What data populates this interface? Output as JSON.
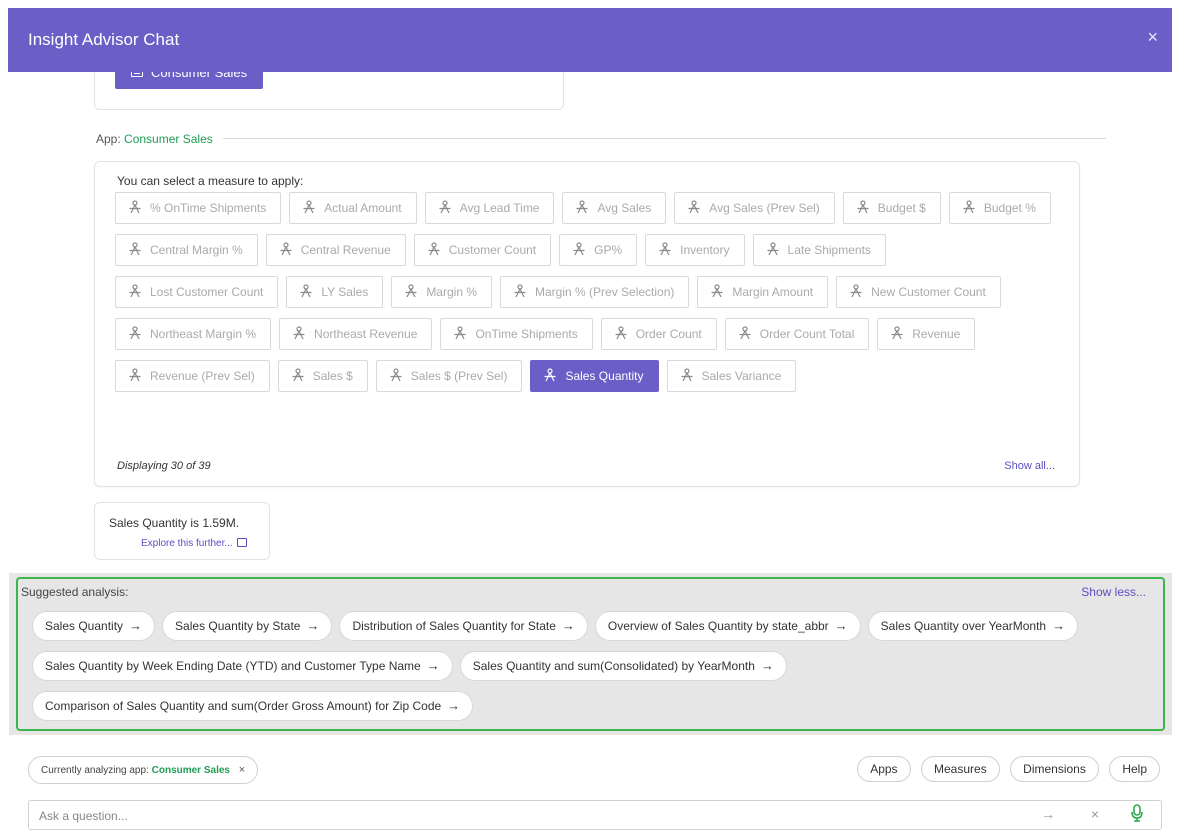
{
  "header": {
    "title": "Insight Advisor Chat",
    "close_glyph": "×"
  },
  "previous": {
    "app_button": "Consumer Sales"
  },
  "app_line": {
    "prefix": "App:",
    "app_name": "Consumer Sales"
  },
  "measures": {
    "intro": "You can select a measure to apply:",
    "items": [
      {
        "label": "% OnTime Shipments",
        "selected": false
      },
      {
        "label": "Actual Amount",
        "selected": false
      },
      {
        "label": "Avg Lead Time",
        "selected": false
      },
      {
        "label": "Avg Sales",
        "selected": false
      },
      {
        "label": "Avg Sales (Prev Sel)",
        "selected": false
      },
      {
        "label": "Budget $",
        "selected": false
      },
      {
        "label": "Budget %",
        "selected": false
      },
      {
        "label": "Central Margin %",
        "selected": false
      },
      {
        "label": "Central Revenue",
        "selected": false
      },
      {
        "label": "Customer Count",
        "selected": false
      },
      {
        "label": "GP%",
        "selected": false
      },
      {
        "label": "Inventory",
        "selected": false
      },
      {
        "label": "Late Shipments",
        "selected": false
      },
      {
        "label": "Lost Customer Count",
        "selected": false
      },
      {
        "label": "LY Sales",
        "selected": false
      },
      {
        "label": "Margin %",
        "selected": false
      },
      {
        "label": "Margin % (Prev Selection)",
        "selected": false
      },
      {
        "label": "Margin Amount",
        "selected": false
      },
      {
        "label": "New Customer Count",
        "selected": false
      },
      {
        "label": "Northeast Margin %",
        "selected": false
      },
      {
        "label": "Northeast Revenue",
        "selected": false
      },
      {
        "label": "OnTime Shipments",
        "selected": false
      },
      {
        "label": "Order Count",
        "selected": false
      },
      {
        "label": "Order Count Total",
        "selected": false
      },
      {
        "label": "Revenue",
        "selected": false
      },
      {
        "label": "Revenue (Prev Sel)",
        "selected": false
      },
      {
        "label": "Sales $",
        "selected": false
      },
      {
        "label": "Sales $ (Prev Sel)",
        "selected": false
      },
      {
        "label": "Sales Quantity",
        "selected": true
      },
      {
        "label": "Sales Variance",
        "selected": false
      }
    ],
    "displaying": "Displaying 30 of 39",
    "show_all": "Show all..."
  },
  "answer": {
    "text": "Sales Quantity is 1.59M.",
    "explore": "Explore this further..."
  },
  "suggested": {
    "title": "Suggested analysis:",
    "show_less": "Show less...",
    "items": [
      "Sales Quantity",
      "Sales Quantity by State",
      "Distribution of Sales Quantity for State",
      "Overview of Sales Quantity by state_abbr",
      "Sales Quantity over YearMonth",
      "Sales Quantity by Week Ending Date (YTD) and Customer Type Name",
      "Sales Quantity and sum(Consolidated) by YearMonth",
      "Comparison of Sales Quantity and sum(Order Gross Amount) for Zip Code"
    ],
    "arrow_glyph": "→"
  },
  "footer": {
    "context_prefix": "Currently analyzing app:",
    "context_app": "Consumer Sales",
    "context_remove": "×",
    "buttons": [
      "Apps",
      "Measures",
      "Dimensions",
      "Help"
    ],
    "ask_placeholder": "Ask a question...",
    "send_glyph": "→",
    "clear_glyph": "×"
  },
  "colors": {
    "accent": "#6b5fc7",
    "app_green": "#1f9d55",
    "highlight_outline": "#3cb54a",
    "mic_green": "#2fa84f"
  }
}
